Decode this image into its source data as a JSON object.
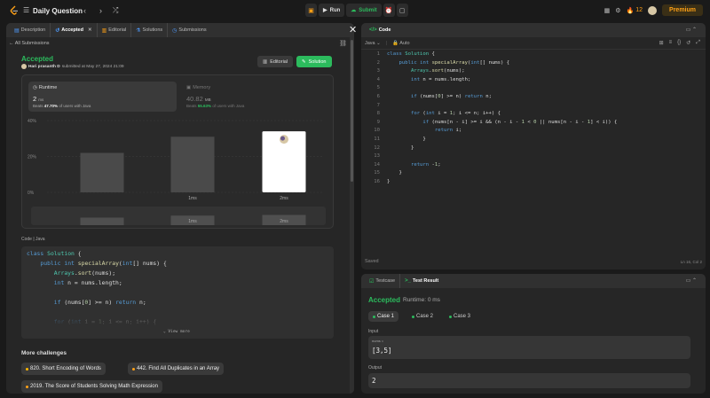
{
  "topbar": {
    "title": "Daily Question",
    "run_label": "Run",
    "submit_label": "Submit",
    "streak_count": "12",
    "premium_label": "Premium"
  },
  "left_tabs": [
    {
      "label": "Description"
    },
    {
      "label": "Accepted"
    },
    {
      "label": "Editorial"
    },
    {
      "label": "Solutions"
    },
    {
      "label": "Submissions"
    }
  ],
  "submission": {
    "back_link": "All Submissions",
    "status": "Accepted",
    "author": "Hari prasanth D",
    "submitted_at": "submitted at May 27, 2024 21:09",
    "editorial_btn": "Editorial",
    "solution_btn": "Solution",
    "runtime": {
      "label": "Runtime",
      "value": "2",
      "unit": "ms",
      "beats_label": "Beats",
      "beats_value": "47.70%",
      "beats_suffix": "of users with Java"
    },
    "memory": {
      "label": "Memory",
      "value": "40.82",
      "unit": "MB",
      "beats_label": "Beats",
      "beats_value": "55.63%",
      "beats_suffix": "of users with Java"
    },
    "code_lang": "Code  |  Java",
    "view_more": "View more"
  },
  "chart_data": {
    "type": "bar",
    "categories": [
      "",
      "1ms",
      "2ms"
    ],
    "values": [
      22,
      31,
      34
    ],
    "highlight_index": 2,
    "y_ticks": [
      "40%",
      "20%",
      "0%"
    ],
    "ylim": [
      0,
      40
    ],
    "minimap_labels": [
      "1ms",
      "2ms"
    ],
    "grid": true
  },
  "left_code": [
    "class Solution {",
    "    public int specialArray(int[] nums) {",
    "        Arrays.sort(nums);",
    "        int n = nums.length;",
    "",
    "        if (nums[0] >= n) return n;",
    "",
    "        for (int i = 1; i <= n; i++) {",
    "            if (nums[n - i] >= i && (n - i - 1 < 0 || nums[n - i - 1] < i)) {"
  ],
  "more": {
    "title": "More challenges",
    "items": [
      {
        "label": "820. Short Encoding of Words"
      },
      {
        "label": "442. Find All Duplicates in an Array"
      },
      {
        "label": "2019. The Score of Students Solving Math Expression"
      }
    ]
  },
  "editor": {
    "tab_label": "Code",
    "language": "Java",
    "auto_label": "Auto",
    "saved_label": "Saved",
    "cursor": "Ln 16, Col 2",
    "line_numbers": [
      "1",
      "2",
      "3",
      "4",
      "5",
      "6",
      "7",
      "8",
      "9",
      "10",
      "11",
      "12",
      "13",
      "14",
      "15",
      "16"
    ],
    "lines": [
      "class Solution {",
      "    public int specialArray(int[] nums) {",
      "        Arrays.sort(nums);",
      "        int n = nums.length;",
      "",
      "        if (nums[0] >= n) return n;",
      "",
      "        for (int i = 1; i <= n; i++) {",
      "            if (nums[n - i] >= i && (n - i - 1 < 0 || nums[n - i - 1] < i)) {",
      "                return i;",
      "            }",
      "        }",
      "",
      "        return -1;",
      "    }",
      "}"
    ]
  },
  "test": {
    "testcase_tab": "Testcase",
    "result_tab": "Test Result",
    "status": "Accepted",
    "runtime": "Runtime: 0 ms",
    "cases": [
      {
        "label": "Case 1"
      },
      {
        "label": "Case 2"
      },
      {
        "label": "Case 3"
      }
    ],
    "input_label": "Input",
    "input_name": "nums =",
    "input_value": "[3,5]",
    "output_label": "Output",
    "output_value": "2"
  },
  "colors": {
    "accent_green": "#2cbb5d",
    "brand_orange": "#ffa116",
    "panel_bg": "#262626",
    "page_bg": "#1a1a1a"
  }
}
